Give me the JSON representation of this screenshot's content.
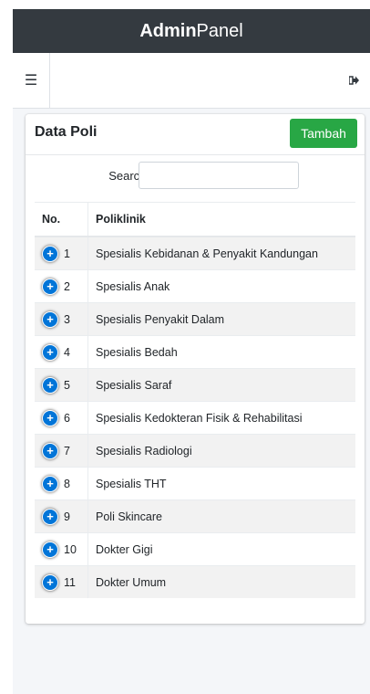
{
  "brand": {
    "bold": "Admin",
    "light": "Panel"
  },
  "nav": {
    "menu_icon": "hamburger-icon",
    "logout_icon": "sign-out-icon"
  },
  "card": {
    "title": "Data Poli",
    "add_button": "Tambah"
  },
  "search": {
    "label": "Search:",
    "value": ""
  },
  "table": {
    "headers": [
      "No.",
      "Poliklinik"
    ],
    "rows": [
      {
        "no": "1",
        "name": "Spesialis Kebidanan & Penyakit Kandungan"
      },
      {
        "no": "2",
        "name": "Spesialis Anak"
      },
      {
        "no": "3",
        "name": "Spesialis Penyakit Dalam"
      },
      {
        "no": "4",
        "name": "Spesialis Bedah"
      },
      {
        "no": "5",
        "name": "Spesialis Saraf"
      },
      {
        "no": "6",
        "name": "Spesialis Kedokteran Fisik & Rehabilitasi"
      },
      {
        "no": "7",
        "name": "Spesialis Radiologi"
      },
      {
        "no": "8",
        "name": "Spesialis THT"
      },
      {
        "no": "9",
        "name": "Poli Skincare"
      },
      {
        "no": "10",
        "name": "Dokter Gigi"
      },
      {
        "no": "11",
        "name": "Dokter Umum"
      }
    ]
  },
  "colors": {
    "brand_bar": "#343a40",
    "add_button": "#28a745",
    "expand_icon": "#0275d8"
  }
}
